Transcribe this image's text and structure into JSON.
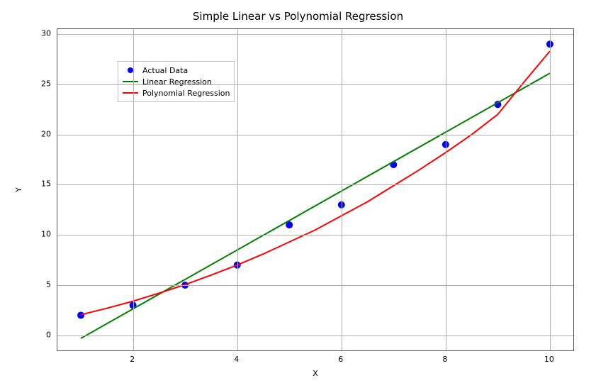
{
  "chart_data": {
    "type": "scatter",
    "title": "Simple Linear vs Polynomial Regression",
    "xlabel": "X",
    "ylabel": "Y",
    "xlim": [
      0.55,
      10.45
    ],
    "ylim": [
      -1.5,
      30.5
    ],
    "x_ticks": [
      2,
      4,
      6,
      8,
      10
    ],
    "y_ticks": [
      0,
      5,
      10,
      15,
      20,
      25,
      30
    ],
    "grid": true,
    "legend_position": "upper-left",
    "series": [
      {
        "name": "Actual Data",
        "kind": "scatter",
        "color": "#0000ff",
        "x": [
          1,
          2,
          3,
          4,
          5,
          6,
          7,
          8,
          9,
          10
        ],
        "y": [
          2,
          3,
          5,
          7,
          11,
          13,
          17,
          19,
          23,
          29
        ]
      },
      {
        "name": "Linear Regression",
        "kind": "line",
        "color": "#008000",
        "x": [
          1,
          10
        ],
        "y": [
          -0.3,
          26.1
        ]
      },
      {
        "name": "Polynomial Regression",
        "kind": "line",
        "color": "#ff0000",
        "x": [
          1,
          1.5,
          2,
          2.5,
          3,
          3.5,
          4,
          4.5,
          5,
          5.5,
          6,
          6.5,
          7,
          7.5,
          8,
          8.5,
          9,
          9.5,
          10
        ],
        "y": [
          2.05,
          2.7,
          3.4,
          4.2,
          5.05,
          6.0,
          7.0,
          8.1,
          9.3,
          10.5,
          11.9,
          13.3,
          14.9,
          16.5,
          18.2,
          20.0,
          22.0,
          25.2,
          28.3
        ]
      }
    ]
  }
}
